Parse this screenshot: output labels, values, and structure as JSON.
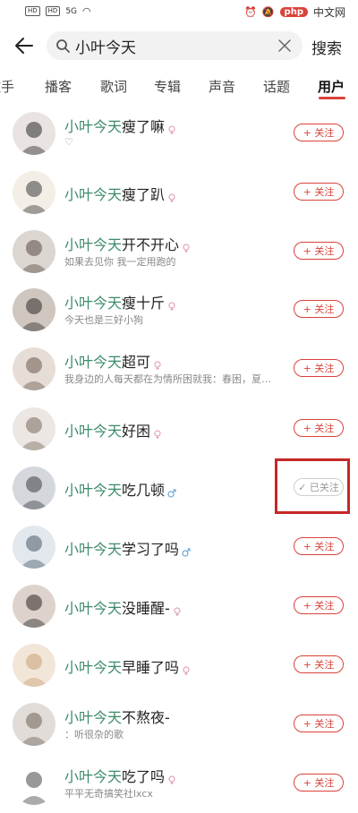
{
  "status_bar": {
    "sim1": "HD",
    "sim2": "HD",
    "network": "5G",
    "right_badge": "php",
    "right_text": "中文网"
  },
  "search": {
    "query": "小叶今天",
    "button_label": "搜索"
  },
  "tabs": [
    {
      "label": "歌手"
    },
    {
      "label": "播客"
    },
    {
      "label": "歌词"
    },
    {
      "label": "专辑"
    },
    {
      "label": "声音"
    },
    {
      "label": "话题"
    },
    {
      "label": "用户"
    }
  ],
  "follow_label": "+ 关注",
  "followed_label": "✓ 已关注",
  "users": [
    {
      "name_highlight": "小叶今天",
      "name_rest": "瘦了嘛",
      "gender": "female",
      "desc": "♡",
      "followed": false
    },
    {
      "name_highlight": "小叶今天",
      "name_rest": "瘦了趴",
      "gender": "female",
      "desc": "",
      "followed": false
    },
    {
      "name_highlight": "小叶今天",
      "name_rest": "开不开心",
      "gender": "female",
      "desc": "如果去见你 我一定用跑的",
      "followed": false
    },
    {
      "name_highlight": "小叶今天",
      "name_rest": "瘦十斤",
      "gender": "female",
      "desc": "今天也是三好小狗",
      "followed": false
    },
    {
      "name_highlight": "小叶今天",
      "name_rest": "超可",
      "gender": "female",
      "desc": "我身边的人每天都在为情所困就我：春困，夏…",
      "followed": false
    },
    {
      "name_highlight": "小叶今天",
      "name_rest": "好困",
      "gender": "female",
      "desc": "",
      "followed": false
    },
    {
      "name_highlight": "小叶今天",
      "name_rest": "吃几顿",
      "gender": "male",
      "desc": "",
      "followed": true
    },
    {
      "name_highlight": "小叶今天",
      "name_rest": "学习了吗",
      "gender": "male",
      "desc": "",
      "followed": false
    },
    {
      "name_highlight": "小叶今天",
      "name_rest": "没睡醒-",
      "gender": "female",
      "desc": "",
      "followed": false
    },
    {
      "name_highlight": "小叶今天",
      "name_rest": "早睡了吗",
      "gender": "female",
      "desc": "",
      "followed": false
    },
    {
      "name_highlight": "小叶今天",
      "name_rest": "不熬夜-",
      "gender": "",
      "desc": "：听很杂的歌",
      "followed": false
    },
    {
      "name_highlight": "小叶今天",
      "name_rest": "吃了吗",
      "gender": "female",
      "desc": "平平无奇搞笑社lxcx",
      "followed": false
    }
  ],
  "colors": {
    "accent": "#d9433a",
    "name_highlight": "#3d8b6a",
    "annotation_box": "#c62828"
  }
}
